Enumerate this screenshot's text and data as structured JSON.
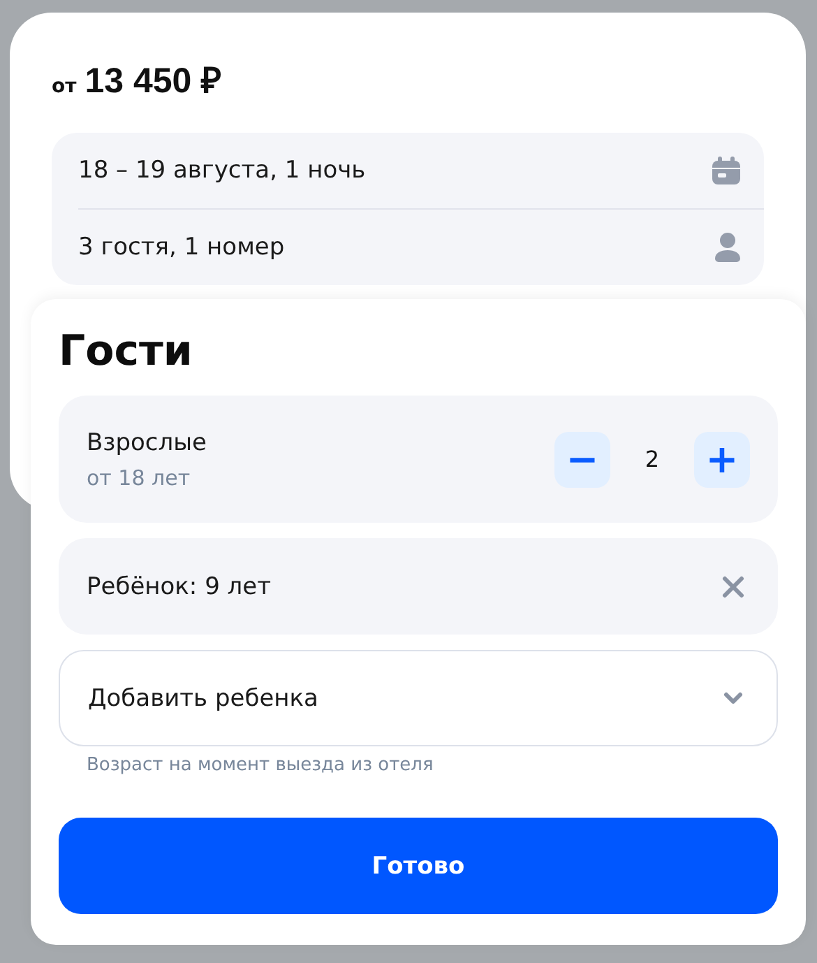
{
  "price": {
    "prefix": "от",
    "amount": "13 450 ₽"
  },
  "summary": [
    {
      "kind": "dates",
      "text": "18 – 19 августа, 1 ночь"
    },
    {
      "kind": "guests",
      "text": "3 гостя, 1 номер"
    }
  ],
  "guests_sheet": {
    "title": "Гости",
    "adults": {
      "label": "Взрослые",
      "hint": "от 18 лет",
      "minus": "−",
      "count": "2",
      "plus": "+"
    },
    "children": [
      {
        "label": "Ребёнок: 9 лет"
      }
    ],
    "add_child": {
      "placeholder": "Добавить ребенка",
      "note": "Возраст на момент выезда из отеля"
    },
    "done_button": "Готово"
  }
}
